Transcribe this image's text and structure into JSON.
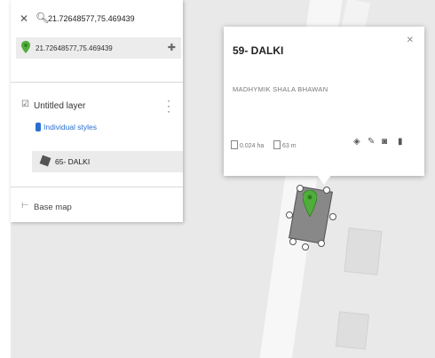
{
  "search": {
    "query": "21.72648577,75.469439"
  },
  "result": {
    "coordinates": "21.72648577,75.469439"
  },
  "layer": {
    "name": "Untitled layer",
    "styles_label": "Individual styles",
    "feature_label": "65- DALKI"
  },
  "basemap": {
    "label": "Base map"
  },
  "popup": {
    "title": "59- DALKI",
    "description": "MADHYMIK SHALA BHAWAN",
    "area": "0.024 ha",
    "perimeter": "63 m"
  },
  "colors": {
    "pin_green": "#4fae3a",
    "link_blue": "#2a6fd0",
    "polygon_fill": "#888888"
  }
}
